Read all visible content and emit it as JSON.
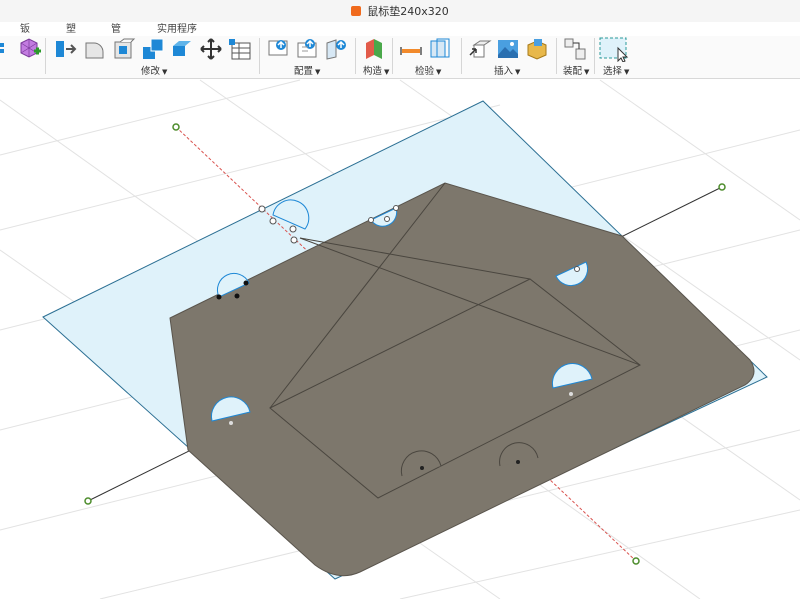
{
  "window": {
    "title": "鼠标垫240x320"
  },
  "tabs": [
    "钣金",
    "塑料",
    "管理",
    "实用程序"
  ],
  "toolbar": {
    "groups": {
      "modify": "修改",
      "configure": "配置",
      "construct": "构造",
      "inspect": "检验",
      "insert": "插入",
      "assemble": "装配",
      "select": "选择"
    }
  },
  "colors": {
    "accent": "#1e88d6",
    "mat_fill": "#7d776c",
    "mat_edge": "#5a554d",
    "sketch_plane": "#dff2fa",
    "sketch_edge": "#2b6f93",
    "origin_red": "#d9534f",
    "constraint_point": "#4c8c2b",
    "grid": "#e2e2e2"
  },
  "icons": [
    "extrude-icon",
    "fillet-icon",
    "shell-icon",
    "combine-icon",
    "offset-face-icon",
    "move-icon",
    "align-icon",
    "parameters-icon",
    "configure-icon",
    "construct-plane-icon",
    "measure-icon",
    "section-icon",
    "insert-derive-icon",
    "insert-image-icon",
    "decal-icon",
    "joint-icon",
    "select-icon"
  ]
}
